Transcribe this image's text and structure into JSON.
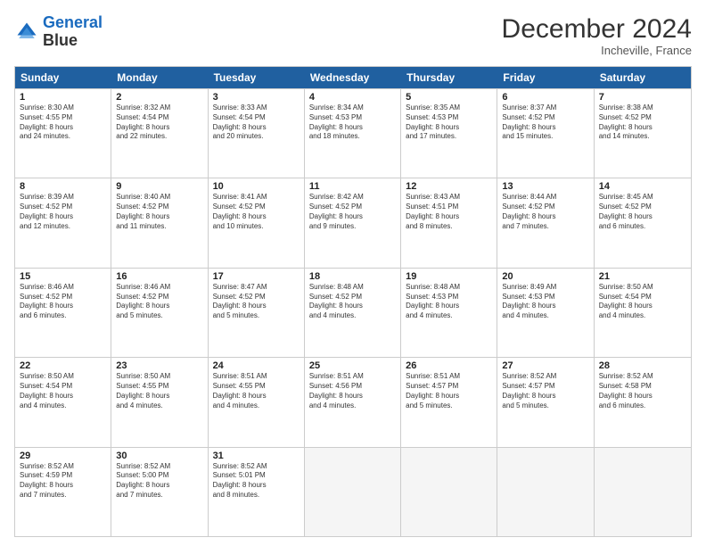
{
  "logo": {
    "line1": "General",
    "line2": "Blue"
  },
  "title": "December 2024",
  "location": "Incheville, France",
  "days_header": [
    "Sunday",
    "Monday",
    "Tuesday",
    "Wednesday",
    "Thursday",
    "Friday",
    "Saturday"
  ],
  "weeks": [
    [
      {
        "day": "1",
        "lines": [
          "Sunrise: 8:30 AM",
          "Sunset: 4:55 PM",
          "Daylight: 8 hours",
          "and 24 minutes."
        ]
      },
      {
        "day": "2",
        "lines": [
          "Sunrise: 8:32 AM",
          "Sunset: 4:54 PM",
          "Daylight: 8 hours",
          "and 22 minutes."
        ]
      },
      {
        "day": "3",
        "lines": [
          "Sunrise: 8:33 AM",
          "Sunset: 4:54 PM",
          "Daylight: 8 hours",
          "and 20 minutes."
        ]
      },
      {
        "day": "4",
        "lines": [
          "Sunrise: 8:34 AM",
          "Sunset: 4:53 PM",
          "Daylight: 8 hours",
          "and 18 minutes."
        ]
      },
      {
        "day": "5",
        "lines": [
          "Sunrise: 8:35 AM",
          "Sunset: 4:53 PM",
          "Daylight: 8 hours",
          "and 17 minutes."
        ]
      },
      {
        "day": "6",
        "lines": [
          "Sunrise: 8:37 AM",
          "Sunset: 4:52 PM",
          "Daylight: 8 hours",
          "and 15 minutes."
        ]
      },
      {
        "day": "7",
        "lines": [
          "Sunrise: 8:38 AM",
          "Sunset: 4:52 PM",
          "Daylight: 8 hours",
          "and 14 minutes."
        ]
      }
    ],
    [
      {
        "day": "8",
        "lines": [
          "Sunrise: 8:39 AM",
          "Sunset: 4:52 PM",
          "Daylight: 8 hours",
          "and 12 minutes."
        ]
      },
      {
        "day": "9",
        "lines": [
          "Sunrise: 8:40 AM",
          "Sunset: 4:52 PM",
          "Daylight: 8 hours",
          "and 11 minutes."
        ]
      },
      {
        "day": "10",
        "lines": [
          "Sunrise: 8:41 AM",
          "Sunset: 4:52 PM",
          "Daylight: 8 hours",
          "and 10 minutes."
        ]
      },
      {
        "day": "11",
        "lines": [
          "Sunrise: 8:42 AM",
          "Sunset: 4:52 PM",
          "Daylight: 8 hours",
          "and 9 minutes."
        ]
      },
      {
        "day": "12",
        "lines": [
          "Sunrise: 8:43 AM",
          "Sunset: 4:51 PM",
          "Daylight: 8 hours",
          "and 8 minutes."
        ]
      },
      {
        "day": "13",
        "lines": [
          "Sunrise: 8:44 AM",
          "Sunset: 4:52 PM",
          "Daylight: 8 hours",
          "and 7 minutes."
        ]
      },
      {
        "day": "14",
        "lines": [
          "Sunrise: 8:45 AM",
          "Sunset: 4:52 PM",
          "Daylight: 8 hours",
          "and 6 minutes."
        ]
      }
    ],
    [
      {
        "day": "15",
        "lines": [
          "Sunrise: 8:46 AM",
          "Sunset: 4:52 PM",
          "Daylight: 8 hours",
          "and 6 minutes."
        ]
      },
      {
        "day": "16",
        "lines": [
          "Sunrise: 8:46 AM",
          "Sunset: 4:52 PM",
          "Daylight: 8 hours",
          "and 5 minutes."
        ]
      },
      {
        "day": "17",
        "lines": [
          "Sunrise: 8:47 AM",
          "Sunset: 4:52 PM",
          "Daylight: 8 hours",
          "and 5 minutes."
        ]
      },
      {
        "day": "18",
        "lines": [
          "Sunrise: 8:48 AM",
          "Sunset: 4:52 PM",
          "Daylight: 8 hours",
          "and 4 minutes."
        ]
      },
      {
        "day": "19",
        "lines": [
          "Sunrise: 8:48 AM",
          "Sunset: 4:53 PM",
          "Daylight: 8 hours",
          "and 4 minutes."
        ]
      },
      {
        "day": "20",
        "lines": [
          "Sunrise: 8:49 AM",
          "Sunset: 4:53 PM",
          "Daylight: 8 hours",
          "and 4 minutes."
        ]
      },
      {
        "day": "21",
        "lines": [
          "Sunrise: 8:50 AM",
          "Sunset: 4:54 PM",
          "Daylight: 8 hours",
          "and 4 minutes."
        ]
      }
    ],
    [
      {
        "day": "22",
        "lines": [
          "Sunrise: 8:50 AM",
          "Sunset: 4:54 PM",
          "Daylight: 8 hours",
          "and 4 minutes."
        ]
      },
      {
        "day": "23",
        "lines": [
          "Sunrise: 8:50 AM",
          "Sunset: 4:55 PM",
          "Daylight: 8 hours",
          "and 4 minutes."
        ]
      },
      {
        "day": "24",
        "lines": [
          "Sunrise: 8:51 AM",
          "Sunset: 4:55 PM",
          "Daylight: 8 hours",
          "and 4 minutes."
        ]
      },
      {
        "day": "25",
        "lines": [
          "Sunrise: 8:51 AM",
          "Sunset: 4:56 PM",
          "Daylight: 8 hours",
          "and 4 minutes."
        ]
      },
      {
        "day": "26",
        "lines": [
          "Sunrise: 8:51 AM",
          "Sunset: 4:57 PM",
          "Daylight: 8 hours",
          "and 5 minutes."
        ]
      },
      {
        "day": "27",
        "lines": [
          "Sunrise: 8:52 AM",
          "Sunset: 4:57 PM",
          "Daylight: 8 hours",
          "and 5 minutes."
        ]
      },
      {
        "day": "28",
        "lines": [
          "Sunrise: 8:52 AM",
          "Sunset: 4:58 PM",
          "Daylight: 8 hours",
          "and 6 minutes."
        ]
      }
    ],
    [
      {
        "day": "29",
        "lines": [
          "Sunrise: 8:52 AM",
          "Sunset: 4:59 PM",
          "Daylight: 8 hours",
          "and 7 minutes."
        ]
      },
      {
        "day": "30",
        "lines": [
          "Sunrise: 8:52 AM",
          "Sunset: 5:00 PM",
          "Daylight: 8 hours",
          "and 7 minutes."
        ]
      },
      {
        "day": "31",
        "lines": [
          "Sunrise: 8:52 AM",
          "Sunset: 5:01 PM",
          "Daylight: 8 hours",
          "and 8 minutes."
        ]
      },
      null,
      null,
      null,
      null
    ]
  ]
}
